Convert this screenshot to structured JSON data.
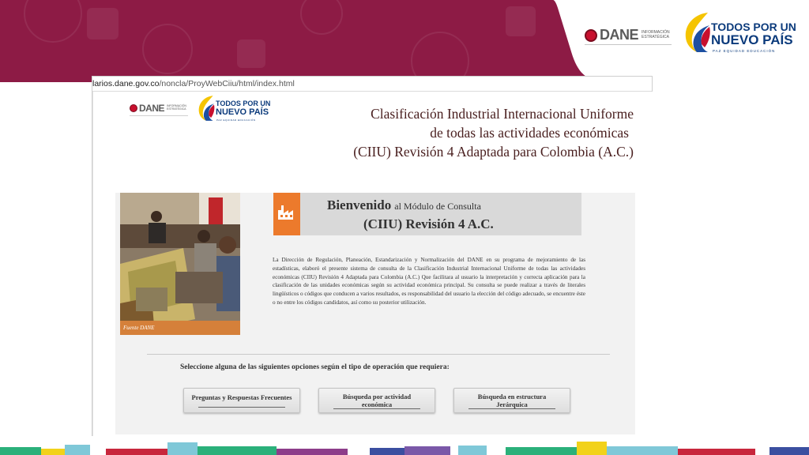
{
  "banner": {
    "dane_word": "DANE",
    "dane_sub_line1": "INFORMACIÓN",
    "dane_sub_line2": "ESTRATÉGICA",
    "tpu_line1": "TODOS POR UN",
    "tpu_line2": "NUEVO PAÍS",
    "tpu_sub": "PAZ  EQUIDAD  EDUCACIÓN",
    "brand_color": "#8d1b45"
  },
  "browser": {
    "url_host": "larios.dane.gov.co",
    "url_path": "/noncla/ProyWebCiiu/html/index.html"
  },
  "page": {
    "header_logos": {
      "dane_word": "DANE",
      "dane_sub_line1": "INFORMACIÓN",
      "dane_sub_line2": "ESTRATÉGICA",
      "tpu_line1": "TODOS POR UN",
      "tpu_line2": "NUEVO PAÍS",
      "tpu_sub": "PAZ  EQUIDAD  EDUCACIÓN"
    },
    "title_line1": "Clasificación Industrial Internacional Uniforme",
    "title_line2": "de todas las actividades económicas",
    "title_line3": "(CIIU) Revisión 4 Adaptada para Colombia (A.C.)",
    "photo_caption": "Fuente DANE",
    "welcome_big": "Bienvenido",
    "welcome_small": "al Módulo de Consulta",
    "welcome_line2": "(CIIU) Revisión 4 A.C.",
    "description": "La Dirección de Regulación, Planeación, Estandarización y Normalización del DANE en su programa de mejoramiento de las estadísticas, elaboró el presente sistema de consulta de la Clasificación Industrial Internacional Uniforme de todas las actividades económicas (CIIU) Revisión 4 Adaptada para Colombia (A.C.) Que facilitara al usuario la interpretación y correcta aplicación para la clasificación de las unidades económicas según su actividad económica principal. Su consulta se puede realizar a través de literales lingüísticos o códigos que conducen a varios resultados, es responsabilidad del usuario la elección del código adecuado, se encuentre éste o no entre los códigos candidatos, así como su posterior utilización.",
    "select_prompt": "Seleccione alguna de las siguientes opciones según el tipo de operación que requiera:",
    "buttons": {
      "faq": "Preguntas y Respuestas Frecuentes",
      "activity_l1": "Búsqueda por actividad",
      "activity_l2": "económica",
      "hier_l1": "Búsqueda en estructura",
      "hier_l2": "Jerárquica"
    }
  },
  "colors": {
    "accent_orange": "#ec7a2c",
    "title_color": "#4a2020",
    "tpu_blue": "#0c3b7c"
  }
}
